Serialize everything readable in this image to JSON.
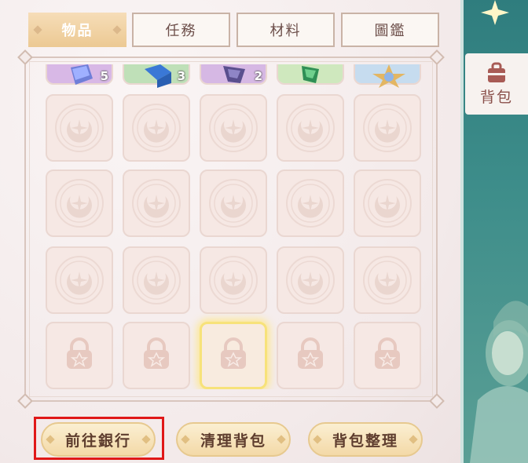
{
  "tabs": [
    {
      "label": "物品",
      "active": true
    },
    {
      "label": "任務",
      "active": false
    },
    {
      "label": "材料",
      "active": false
    },
    {
      "label": "圖鑑",
      "active": false
    }
  ],
  "items_row": [
    {
      "count": "5",
      "color": "#d8b8e6"
    },
    {
      "count": "3",
      "color": "#bfe0b8"
    },
    {
      "count": "2",
      "color": "#d6b8e4"
    },
    {
      "count": "",
      "color": "#cfe8be"
    },
    {
      "count": "",
      "color": "#c6dcef"
    }
  ],
  "buttons": {
    "bank": "前往銀行",
    "clear": "清理背包",
    "sort": "背包整理"
  },
  "side": {
    "backpack_label": "背包"
  },
  "colors": {
    "highlight": "#e01818",
    "selected_glow": "#f7e27a",
    "button_fill": "#f3d9a7"
  }
}
